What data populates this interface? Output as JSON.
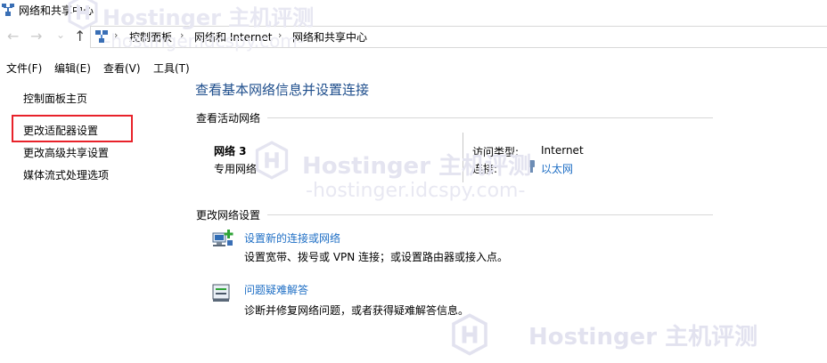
{
  "window": {
    "title": "网络和共享中心"
  },
  "nav": {
    "back": "←",
    "forward": "→",
    "dropdown": "⌄",
    "up": "↑"
  },
  "breadcrumb": {
    "items": [
      "控制面板",
      "网络和 Internet",
      "网络和共享中心"
    ],
    "separator": "›"
  },
  "menubar": {
    "items": [
      "文件(F)",
      "编辑(E)",
      "查看(V)",
      "工具(T)"
    ]
  },
  "sidebar": {
    "items": [
      "控制面板主页",
      "更改适配器设置",
      "更改高级共享设置",
      "媒体流式处理选项"
    ]
  },
  "main": {
    "heading": "查看基本网络信息并设置连接",
    "active_section": "查看活动网络",
    "network_name": "网络 3",
    "network_type": "专用网络",
    "access_type_label": "访问类型:",
    "access_type_value": "Internet",
    "connection_label": "连接:",
    "connection_value": "以太网",
    "change_section": "更改网络设置",
    "tasks": [
      {
        "link": "设置新的连接或网络",
        "desc": "设置宽带、拨号或 VPN 连接；或设置路由器或接入点。"
      },
      {
        "link": "问题疑难解答",
        "desc": "诊断并修复网络问题，或者获得疑难解答信息。"
      }
    ]
  },
  "watermark": {
    "brand": "Hostinger 主机评测",
    "url": "-hostinger.idcspy.com-"
  },
  "colors": {
    "link": "#1f6fc5",
    "heading": "#1e4e8c",
    "highlight_box": "#e8222a"
  }
}
